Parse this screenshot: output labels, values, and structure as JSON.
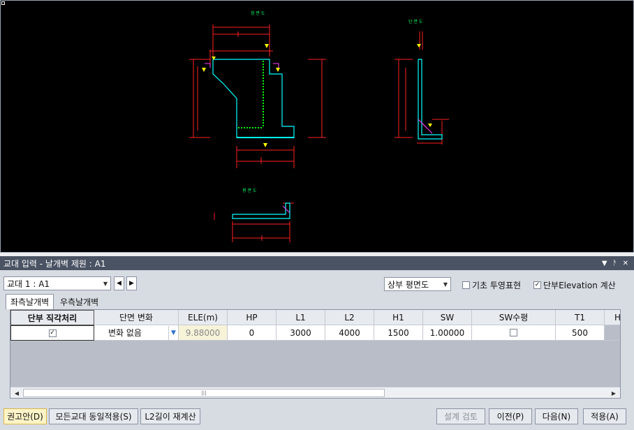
{
  "drawing": {
    "front_view_title": "정 면 도",
    "side_view_title": "단 면 도",
    "plan_view_title": "평 면 도"
  },
  "panel": {
    "title": "교대 입력 - 날개벽 제원 : A1",
    "pin_icon": "pin-icon",
    "close_icon": "close-icon"
  },
  "toolbar": {
    "abutment_select": "교대 1 : A1",
    "view_select": "상부 평면도",
    "foundation_projection_label": "기초 투영표현",
    "foundation_projection_checked": false,
    "end_elevation_label": "단부Elevation 계산",
    "end_elevation_checked": true
  },
  "tabs": [
    {
      "label": "좌측날개벽",
      "active": true
    },
    {
      "label": "우측날개벽",
      "active": false
    }
  ],
  "table": {
    "columns": [
      "단부 직각처리",
      "단면 변화",
      "ELE(m)",
      "HP",
      "L1",
      "L2",
      "H1",
      "SW",
      "SW수평",
      "T1",
      "H"
    ],
    "row": {
      "end_right_angle": true,
      "section_change": "변화 없음",
      "ele": "9.88000",
      "hp": "0",
      "l1": "3000",
      "l2": "4000",
      "h1": "1500",
      "sw": "1.00000",
      "sw_horizontal": false,
      "t1": "500"
    }
  },
  "buttons": {
    "recommend": "권고안(D)",
    "apply_all": "모든교대 동일적용(S)",
    "recalc_l2": "L2길이 재계산",
    "design_check": "설계 검토",
    "prev": "이전(P)",
    "next": "다음(N)",
    "apply": "적용(A)"
  },
  "colors": {
    "cad_background": "#000000",
    "structure_line": "#00ffff",
    "dimension_line": "#ff0000",
    "rebar": "#00ff00",
    "panel_header": "#4a5363"
  }
}
